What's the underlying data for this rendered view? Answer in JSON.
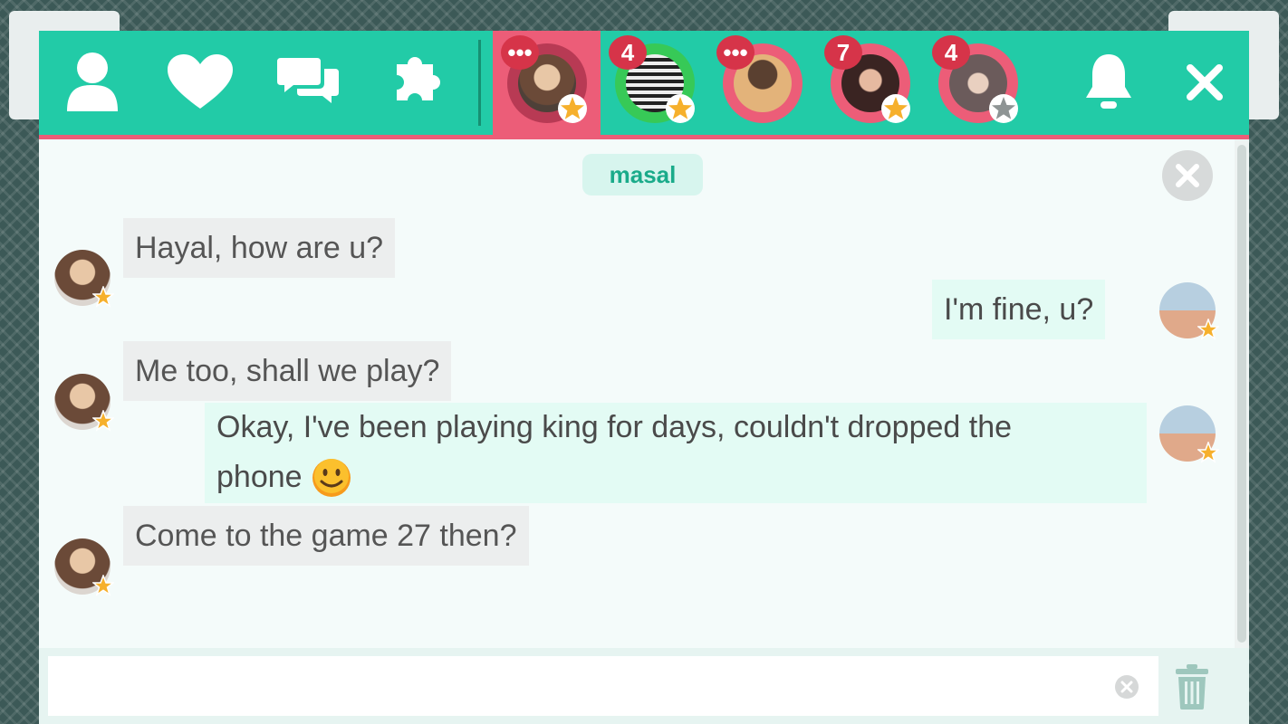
{
  "nav": {
    "icons": [
      "person-icon",
      "heart-icon",
      "chat-icon",
      "puzzle-icon"
    ]
  },
  "conversations": [
    {
      "name": "conversation-1",
      "badge": "•••",
      "ring_color": "#ec5d78",
      "star": "gold",
      "active": true
    },
    {
      "name": "conversation-2",
      "badge": "4",
      "ring_color": "#37c957",
      "star": "gold",
      "active": false
    },
    {
      "name": "conversation-3",
      "badge": "•••",
      "ring_color": "#ec5d78",
      "star": "none",
      "active": false
    },
    {
      "name": "conversation-4",
      "badge": "7",
      "ring_color": "#ec5d78",
      "star": "gold",
      "active": false
    },
    {
      "name": "conversation-5",
      "badge": "4",
      "ring_color": "#ec5d78",
      "star": "gray",
      "active": false
    }
  ],
  "chat": {
    "username": "masal",
    "messages": [
      {
        "direction": "in",
        "text": "Hayal, how are u?"
      },
      {
        "direction": "out",
        "text": "I'm fine, u?"
      },
      {
        "direction": "in",
        "text": "Me too, shall we play?"
      },
      {
        "direction": "out",
        "text_line1": "Okay, I've been playing king for days, couldn't dropped the",
        "text_line2": "phone",
        "emoji": "smiley-emoji"
      },
      {
        "direction": "in",
        "text": "Come to the game 27 then?"
      }
    ]
  },
  "input": {
    "value": "",
    "placeholder": ""
  },
  "colors": {
    "accent": "#22cba7",
    "highlight": "#ec5d78",
    "badge": "#d63449",
    "star": "#f6b02c"
  }
}
